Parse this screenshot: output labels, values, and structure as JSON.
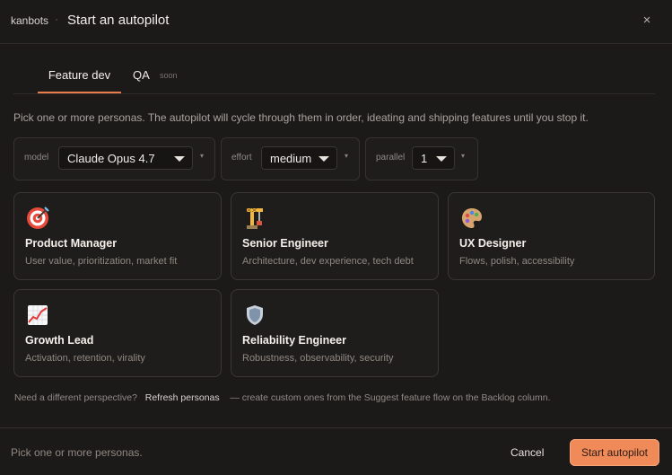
{
  "header": {
    "brand": "kanbots",
    "separator": "·",
    "title": "Start an autopilot",
    "close": "×"
  },
  "tabs": [
    {
      "label": "Feature dev"
    },
    {
      "label": "QA",
      "badge": "soon"
    }
  ],
  "description": "Pick one or more personas. The autopilot will cycle through them in order, ideating and shipping features until you stop it.",
  "controls": {
    "model": {
      "label": "model",
      "value": "Claude Opus 4.7",
      "more": "▾"
    },
    "effort": {
      "label": "effort",
      "value": "medium",
      "more": "▾"
    },
    "parallel": {
      "label": "parallel",
      "value": "1",
      "more": "▾"
    }
  },
  "personas": [
    {
      "icon": "target-emoji-icon",
      "name": "Product Manager",
      "summary": "User value, prioritization, market fit"
    },
    {
      "icon": "crane-emoji-icon",
      "name": "Senior Engineer",
      "summary": "Architecture, dev experience, tech debt"
    },
    {
      "icon": "palette-emoji-icon",
      "name": "UX Designer",
      "summary": "Flows, polish, accessibility"
    },
    {
      "icon": "chart-up-emoji-icon",
      "name": "Growth Lead",
      "summary": "Activation, retention, virality"
    },
    {
      "icon": "shield-emoji-icon",
      "name": "Reliability Engineer",
      "summary": "Robustness, observability, security"
    }
  ],
  "note": {
    "prefix": "Need a different perspective?",
    "link": "Refresh personas",
    "suffix": "— create custom ones from the Suggest feature flow on the Backlog column."
  },
  "footer": {
    "hint": "Pick one or more personas.",
    "cancel": "Cancel",
    "start": "Start autopilot"
  },
  "colors": {
    "background": "#1c1a19",
    "accent": "#f08b59",
    "tab_underline": "#e97c4d"
  }
}
